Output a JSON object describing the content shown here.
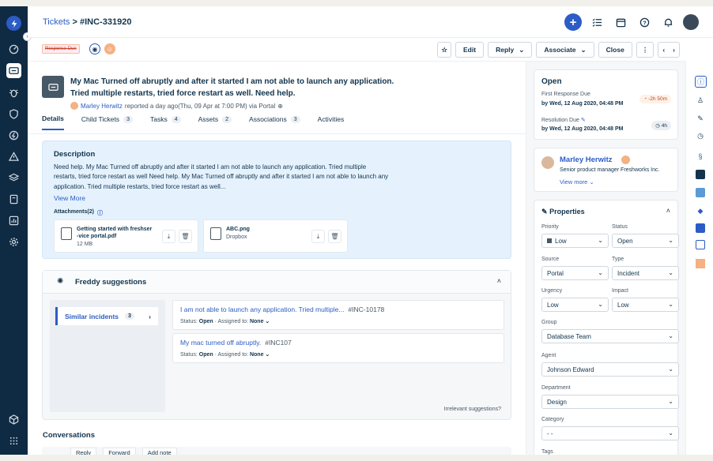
{
  "header": {
    "breadcrumb_root": "Tickets",
    "breadcrumb_sep": ">",
    "ticket_id": "#INC-331920",
    "new_label": "+"
  },
  "toolbar": {
    "response_due_badge": "Response Due",
    "edit_label": "Edit",
    "reply_label": "Reply",
    "associate_label": "Associate",
    "close_label": "Close",
    "more_label": "⋮",
    "prev_label": "‹",
    "next_label": "›"
  },
  "ticket": {
    "subject_line1": "My Mac Turned off abruptly and after it started I am not able to launch any application.",
    "subject_line2": "Tried multiple restarts, tried force restart as well. Need help.",
    "requester": "Marley Herwitz",
    "meta_text": "reported a day ago(Thu, 09 Apr at 7:00 PM) via Portal"
  },
  "tabs": [
    {
      "label": "Details",
      "count": ""
    },
    {
      "label": "Child Tickets",
      "count": "3"
    },
    {
      "label": "Tasks",
      "count": "4"
    },
    {
      "label": "Assets",
      "count": "2"
    },
    {
      "label": "Associations",
      "count": "3"
    },
    {
      "label": "Activities",
      "count": ""
    }
  ],
  "description": {
    "title": "Description",
    "line1": "Need help. My Mac Turned off abruptly and after it started I am not able to launch any application. Tried multiple",
    "line2": "restarts, tried force restart as well Need help. My Mac Turned off abruptly and after it started I am not able to launch any",
    "line3": "application. Tried multiple restarts, tried force restart as well...",
    "view_more": "View More",
    "attachments_label": "Attachments(2)",
    "attachments": [
      {
        "name_line1": "Getting started with freshser",
        "name_line2": "-vice portal.pdf",
        "meta": "12 MB"
      },
      {
        "name_line1": "ABC.png",
        "name_line2": "",
        "meta": "Dropbox"
      }
    ]
  },
  "freddy": {
    "title": "Freddy suggestions",
    "similar_label": "Similar incidents",
    "similar_count": "3",
    "suggestions": [
      {
        "title": "I am not able to launch any application. Tried multiple...",
        "id": "#INC-10178",
        "status_label": "Status:",
        "status": "Open",
        "assigned_label": "Assigned to:",
        "assigned": "None"
      },
      {
        "title": "My mac turned off abruptly.",
        "id": "#INC107",
        "status_label": "Status:",
        "status": "Open",
        "assigned_label": "Assigned to:",
        "assigned": "None"
      }
    ],
    "irrelevant": "Irrelevant suggestions?"
  },
  "conversations": {
    "title": "Conversations",
    "reply": "Reply",
    "forward": "Forward",
    "add_note": "Add note"
  },
  "status_card": {
    "status": "Open",
    "first_response_label": "First Response Due",
    "first_response_value": "by Wed, 12 Aug 2020, 04:48 PM",
    "first_response_pill": "-2h 50m",
    "resolution_label": "Resolution Due",
    "resolution_value": "by Wed, 12 Aug 2020, 04:48 PM",
    "resolution_pill": "4h"
  },
  "requester_card": {
    "name": "Marley Herwitz",
    "title": "Senior product manager Freshworks Inc.",
    "view_more": "View more"
  },
  "properties": {
    "title": "Properties",
    "priority_label": "Priority",
    "priority": "Low",
    "status_label": "Status",
    "status": "Open",
    "source_label": "Source",
    "source": "Portal",
    "type_label": "Type",
    "type": "Incident",
    "urgency_label": "Urgency",
    "urgency": "Low",
    "impact_label": "Impact",
    "impact": "Low",
    "group_label": "Group",
    "group": "Database Team",
    "agent_label": "Agent",
    "agent": "Johnson Edward",
    "department_label": "Department",
    "department": "Design",
    "category_label": "Category",
    "category": "- -",
    "tags_label": "Tags"
  },
  "colors": {
    "nav_bg": "#0f2a43",
    "accent": "#2c5cc5",
    "description_bg": "#e5f2fd",
    "overdue": "#e86f25"
  }
}
